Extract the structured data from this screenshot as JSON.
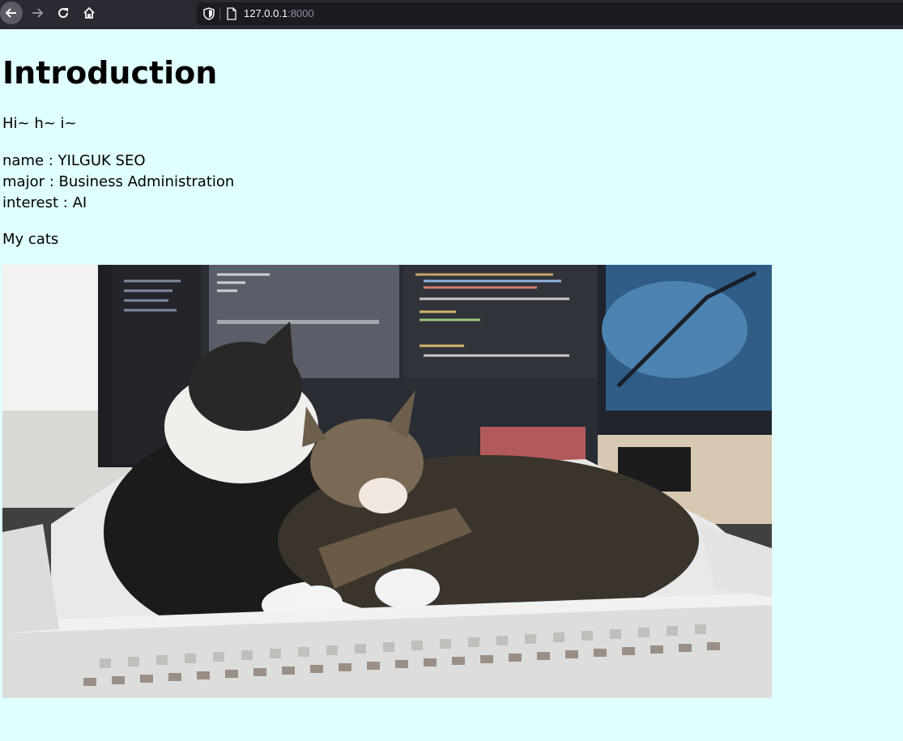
{
  "browser": {
    "url_host": "127.0.0.1",
    "url_port": ":8000",
    "back_icon": "arrow-left-icon",
    "forward_icon": "arrow-right-icon",
    "reload_icon": "reload-icon",
    "home_icon": "home-icon",
    "shield_icon": "shield-icon",
    "page_icon": "page-icon"
  },
  "page": {
    "heading": "Introduction",
    "greeting": "Hi~ h~ i~",
    "info": {
      "name": "name : YILGUK SEO",
      "major": "major : Business Administration",
      "interest": "interest : AI"
    },
    "photo_caption": "My cats",
    "background_color": "#e0ffff"
  }
}
